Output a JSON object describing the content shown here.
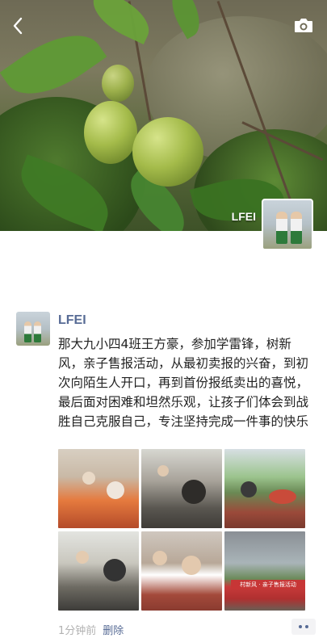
{
  "cover": {
    "name": "LFEI",
    "icons": {
      "back": "back-arrow-icon",
      "camera": "camera-icon"
    }
  },
  "post": {
    "author": "LFEI",
    "text": "那大九小四4班王方豪，参加学雷锋，树新风，亲子售报活动，从最初卖报的兴奋，到初次向陌生人开口，再到首份报纸卖出的喜悦，最后面对困难和坦然乐观，让孩子们体会到战胜自己克服自己，专注坚持完成一件事的快乐",
    "photo_count": 6,
    "photo6_banner": "村新风 · 亲子售报活动",
    "time": "1分钟前",
    "delete_label": "删除",
    "more_icon": "more-dots-icon"
  },
  "colors": {
    "name_link": "#576b95",
    "meta_gray": "#b2b2b2"
  }
}
